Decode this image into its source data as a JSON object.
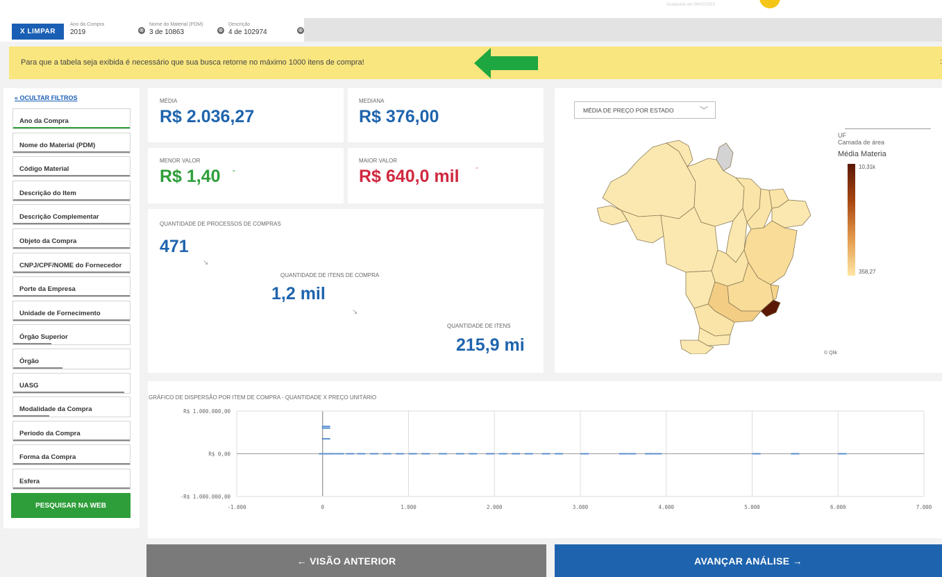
{
  "header": {
    "updated_stamp": "Atualizado em 09/03/2023"
  },
  "selections": {
    "clear_label": "X  LIMPAR",
    "chips": [
      {
        "label": "Ano da Compra",
        "value": "2019"
      },
      {
        "label": "Nome do Material (PDM)",
        "value": "3 de 10863"
      },
      {
        "label": "Descrição",
        "value": "4 de 102974"
      }
    ],
    "remove_icon": "⊗"
  },
  "warning": {
    "text": "Para que a tabela seja exibida é necessário que sua busca retorne no máximo 1000 itens de compra!",
    "arrow_color": "#1ea640",
    "trail": ":"
  },
  "sidebar": {
    "hide_filters": "« OCULTAR FILTROS",
    "filters": [
      {
        "label": "Ano da Compra",
        "fill": 1.0,
        "color": "#2e9e3a"
      },
      {
        "label": "Nome do Material (PDM)",
        "fill": 1.0,
        "color": "#888888"
      },
      {
        "label": "Código Material",
        "fill": 1.0,
        "color": "#888888"
      },
      {
        "label": "Descrição do Item",
        "fill": 1.0,
        "color": "#888888"
      },
      {
        "label": "Descrição Complementar",
        "fill": 1.0,
        "color": "#888888"
      },
      {
        "label": "Objeto da Compra",
        "fill": 1.0,
        "color": "#888888"
      },
      {
        "label": "CNPJ/CPF/NOME do Fornecedor",
        "fill": 1.0,
        "color": "#888888"
      },
      {
        "label": "Porte da Empresa",
        "fill": 1.0,
        "color": "#888888"
      },
      {
        "label": "Unidade de Fornecimento",
        "fill": 1.0,
        "color": "#888888"
      },
      {
        "label": "Órgão Superior",
        "fill": 0.33,
        "color": "#888888"
      },
      {
        "label": "Órgão",
        "fill": 0.42,
        "color": "#888888"
      },
      {
        "label": "UASG",
        "fill": 0.95,
        "color": "#888888"
      },
      {
        "label": "Modalidade da Compra",
        "fill": 0.31,
        "color": "#888888"
      },
      {
        "label": "Período da Compra",
        "fill": 1.0,
        "color": "#888888"
      },
      {
        "label": "Forma da Compra",
        "fill": 1.0,
        "color": "#888888"
      },
      {
        "label": "Esfera",
        "fill": 1.0,
        "color": "#888888"
      }
    ],
    "search_web": "PESQUISAR NA WEB"
  },
  "kpis": {
    "media": {
      "label": "MÉDIA",
      "value": "R$ 2.036,27"
    },
    "mediana": {
      "label": "MEDIANA",
      "value": "R$ 376,00"
    },
    "menor": {
      "label": "MENOR VALOR",
      "value": "R$ 1,40",
      "mark": "ˇ"
    },
    "maior": {
      "label": "MAIOR VALOR",
      "value": "R$ 640,0 mil",
      "mark": "ˊ"
    },
    "processos": {
      "label": "QUANTIDADE DE PROCESSOS DE COMPRAS",
      "value": "471"
    },
    "itens_compra": {
      "label": "QUANTIDADE DE ITENS DE COMPRA",
      "value": "1,2 mil"
    },
    "itens": {
      "label": "QUANTIDADE DE ITENS",
      "value": "215,9 mi"
    },
    "arrow": "↘"
  },
  "map": {
    "dropdown": "MÉDIA DE PREÇO POR ESTADO",
    "chevron": "﹀",
    "legend_title": "UF",
    "legend_layer": "Camada de área",
    "legend_measure": "Média Materia",
    "legend_max": "10,31k",
    "legend_min": "358,27",
    "credit": "© Qlik"
  },
  "chart_data": {
    "type": "scatter",
    "title": "GRÁFICO DE DISPERSÃO POR ITEM DE COMPRA - QUANTIDADE X PREÇO UNITÁRIO",
    "xlim": [
      -1000,
      7000
    ],
    "ylim": [
      -1000000,
      1000000
    ],
    "x_ticks": [
      "-1.000",
      "0",
      "1.000",
      "2.000",
      "3.000",
      "4.000",
      "5.000",
      "6.000",
      "7.000"
    ],
    "y_ticks": [
      "R$ 1.000.000,00",
      "R$ 0,00",
      "-R$ 1.000.000,00"
    ],
    "grid": true,
    "points": [
      {
        "x": 40,
        "y": 640000
      },
      {
        "x": 40,
        "y": 600000
      },
      {
        "x": 40,
        "y": 350000
      },
      {
        "x": 5,
        "y": 0
      },
      {
        "x": 100,
        "y": 0
      },
      {
        "x": 200,
        "y": 0
      },
      {
        "x": 320,
        "y": 0
      },
      {
        "x": 450,
        "y": 0
      },
      {
        "x": 600,
        "y": 0
      },
      {
        "x": 750,
        "y": 0
      },
      {
        "x": 900,
        "y": 0
      },
      {
        "x": 1050,
        "y": 0
      },
      {
        "x": 1200,
        "y": 0
      },
      {
        "x": 1400,
        "y": 0
      },
      {
        "x": 1600,
        "y": 0
      },
      {
        "x": 1750,
        "y": 0
      },
      {
        "x": 1950,
        "y": 0
      },
      {
        "x": 2100,
        "y": 0
      },
      {
        "x": 2250,
        "y": 0
      },
      {
        "x": 2400,
        "y": 0
      },
      {
        "x": 2600,
        "y": 0
      },
      {
        "x": 2750,
        "y": 0
      },
      {
        "x": 3050,
        "y": 0
      },
      {
        "x": 3500,
        "y": 0
      },
      {
        "x": 3600,
        "y": 0
      },
      {
        "x": 3800,
        "y": 0
      },
      {
        "x": 3900,
        "y": 0
      },
      {
        "x": 5050,
        "y": 0
      },
      {
        "x": 5500,
        "y": 0
      },
      {
        "x": 6050,
        "y": 0
      }
    ]
  },
  "nav": {
    "back": "←  VISÃO ANTERIOR",
    "next": "AVANÇAR ANÁLISE  →"
  }
}
